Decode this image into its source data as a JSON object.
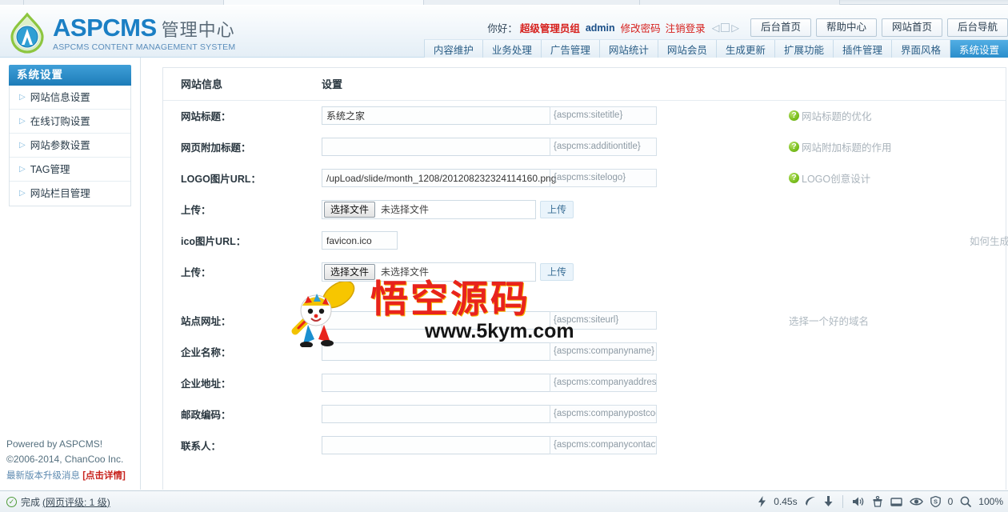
{
  "browser": {
    "tabs": [
      "",
      "",
      "",
      "",
      ""
    ]
  },
  "header": {
    "logo_title": "ASPCMS",
    "logo_title_cn": "管理中心",
    "logo_sub": "ASPCMS CONTENT MANAGEMENT SYSTEM",
    "greeting": "你好：",
    "role": "超级管理员组",
    "username": "admin",
    "change_password": "修改密码",
    "logout": "注销登录",
    "buttons": [
      {
        "label": "后台首页"
      },
      {
        "label": "帮助中心"
      },
      {
        "label": "网站首页"
      },
      {
        "label": "后台导航"
      }
    ]
  },
  "nav": {
    "tabs": [
      {
        "label": "内容维护",
        "active": false
      },
      {
        "label": "业务处理",
        "active": false
      },
      {
        "label": "广告管理",
        "active": false
      },
      {
        "label": "网站统计",
        "active": false
      },
      {
        "label": "网站会员",
        "active": false
      },
      {
        "label": "生成更新",
        "active": false
      },
      {
        "label": "扩展功能",
        "active": false
      },
      {
        "label": "插件管理",
        "active": false
      },
      {
        "label": "界面风格",
        "active": false
      },
      {
        "label": "系统设置",
        "active": true
      }
    ]
  },
  "sidebar": {
    "title": "系统设置",
    "items": [
      {
        "label": "网站信息设置"
      },
      {
        "label": "在线订购设置"
      },
      {
        "label": "网站参数设置"
      },
      {
        "label": "TAG管理"
      },
      {
        "label": "网站栏目管理"
      }
    ],
    "powered": "Powered by ASPCMS!",
    "copyright": "©2006-2014, ChanCoo Inc.",
    "update_text": "最新版本升级消息 ",
    "update_link": "[点击详情]"
  },
  "form": {
    "header_left": "网站信息",
    "header_right": "设置",
    "rows": [
      {
        "type": "text",
        "label": "网站标题：",
        "value": "系统之家",
        "tag": "{aspcms:sitetitle}",
        "hint": "网站标题的优化",
        "hint_icon": true
      },
      {
        "type": "text",
        "label": "网页附加标题：",
        "value": "",
        "tag": "{aspcms:additiontitle}",
        "hint": "网站附加标题的作用",
        "hint_icon": true
      },
      {
        "type": "text",
        "label": "LOGO图片URL：",
        "value": "/upLoad/slide/month_1208/201208232324114160.png",
        "tag": "{aspcms:sitelogo}",
        "hint": "LOGO创意设计",
        "hint_icon": true
      },
      {
        "type": "file",
        "label": "上传：",
        "choose_label": "选择文件",
        "file_status": "未选择文件",
        "upload_label": "上传"
      },
      {
        "type": "text-small",
        "label": "ico图片URL：",
        "value": "favicon.ico",
        "tag": "",
        "hint": "如何生成网站图标",
        "hint_icon": false
      },
      {
        "type": "file",
        "label": "上传：",
        "choose_label": "选择文件",
        "file_status": "未选择文件",
        "upload_label": "上传"
      },
      {
        "type": "spacer"
      },
      {
        "type": "text",
        "label": "站点网址：",
        "value": "",
        "tag": "{aspcms:siteurl}",
        "hint": "选择一个好的域名",
        "hint_icon": false
      },
      {
        "type": "text",
        "label": "企业名称：",
        "value": "",
        "tag": "{aspcms:companyname}",
        "hint": "",
        "hint_icon": false
      },
      {
        "type": "text",
        "label": "企业地址：",
        "value": "",
        "tag": "{aspcms:companyaddress}",
        "hint": "",
        "hint_icon": false
      },
      {
        "type": "text",
        "label": "邮政编码：",
        "value": "",
        "tag": "{aspcms:companypostcode}",
        "hint": "",
        "hint_icon": false
      },
      {
        "type": "text",
        "label": "联系人：",
        "value": "",
        "tag": "{aspcms:companycontact}",
        "hint": "",
        "hint_icon": false
      }
    ]
  },
  "watermark": {
    "cn": "悟空源码",
    "url": "www.5kym.com"
  },
  "statusbar": {
    "status": "完成",
    "rating": "(网页评级: 1 级)",
    "load_time": "0.45s",
    "shield_count": "0",
    "zoom": "100%"
  },
  "colors": {
    "accent": "#2b8ecb",
    "brand_blue": "#1b7fc4",
    "alert_red": "#d6201d",
    "watermark_red": "#e8231c"
  }
}
